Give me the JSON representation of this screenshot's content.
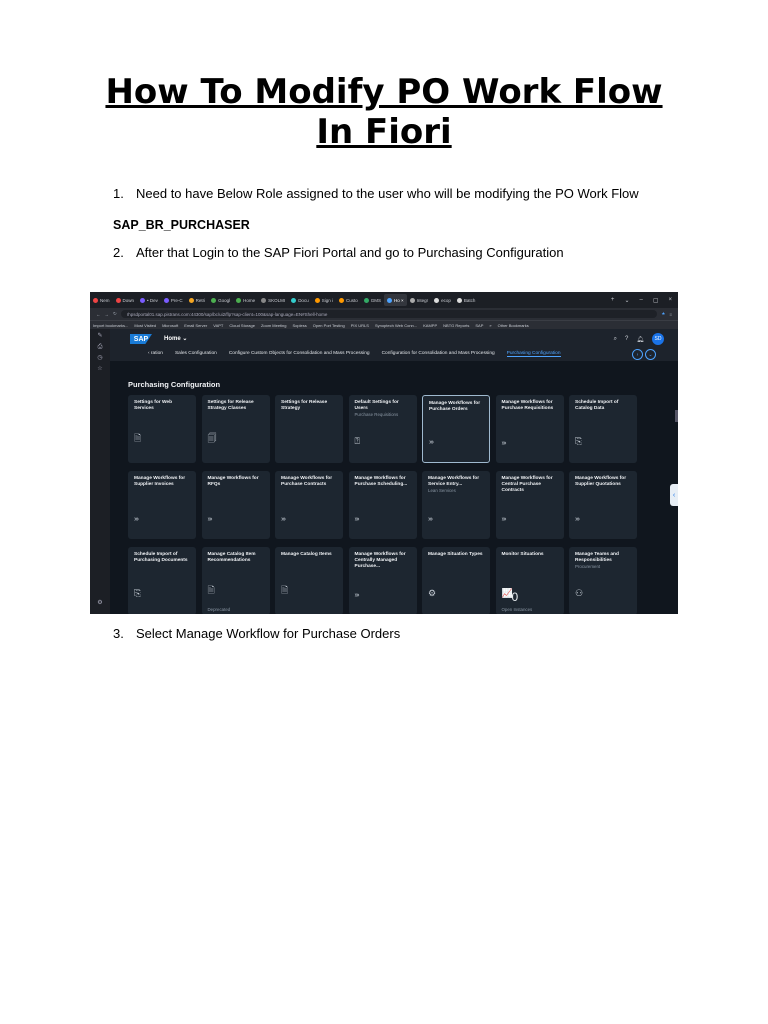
{
  "doc": {
    "title_line1": "How To Modify PO Work Flow",
    "title_line2": "In Fiori",
    "steps": [
      {
        "num": "1.",
        "text": "Need to have Below Role assigned to the user who will be modifying the PO Work Flow"
      },
      {
        "num": "2.",
        "text": "After that Login to the SAP Fiori Portal and go to Purchasing Configuration"
      },
      {
        "num": "3.",
        "text": "Select Manage Workflow for Purchase Orders"
      }
    ],
    "role": "SAP_BR_PURCHASER"
  },
  "screenshot": {
    "browser_tabs": [
      "Nem",
      "Down",
      "• Dev",
      "Pre-C",
      "Retri",
      "Googl",
      "Home",
      "SKOLMI",
      "Docu",
      "Sign i",
      "Custo",
      "GMS",
      "Ho ×",
      "Integr",
      "ecop",
      "Batch"
    ],
    "window_controls": [
      "+",
      "⌄",
      "–",
      "▢",
      "×"
    ],
    "address": "rhpsdportal01.sap.pistrans.com:44300/sap/bc/ui2/flp?sap-client=100&sap-language=EN#Shell-home",
    "bookmarks": [
      "Import bookmarks...",
      "Most Visited",
      "Microsoft",
      "Email Server",
      "VAPT",
      "Cloud Storage",
      "Zoom Meeting",
      "Sopless",
      "Open Port Testing",
      "PIX URLS",
      "Synoptech Web Conn...",
      "KAMPP",
      "NBTG Reports",
      "SAP",
      "»",
      "Other Bookmarks"
    ],
    "header": {
      "logo": "SAP",
      "home": "Home ⌄",
      "avatar": "SD",
      "nav": [
        "‹  ration",
        "Sales Configuration",
        "Configure Custom Objects for Consolidation and Mass Processing",
        "Configuration for Consolidation and Mass Processing",
        "Purchasing Configuration"
      ],
      "nav_selected_index": 4
    },
    "section": "Purchasing Configuration",
    "tiles": [
      {
        "title": "Settings for Web Services",
        "sub": "",
        "icon": "document-icon",
        "glyph": "🗎",
        "foot": ""
      },
      {
        "title": "Settings for Release Strategy Classes",
        "sub": "",
        "icon": "document-stack-icon",
        "glyph": "🗐",
        "foot": ""
      },
      {
        "title": "Settings for Release Strategy",
        "sub": "",
        "icon": "",
        "glyph": "",
        "foot": ""
      },
      {
        "title": "Default Settings for Users",
        "sub": "Purchase Requisitions",
        "icon": "user-settings-icon",
        "glyph": "⍰",
        "foot": ""
      },
      {
        "title": "Manage Workflows for Purchase Orders",
        "sub": "",
        "icon": "workflow-arrows-icon",
        "glyph": "›››",
        "foot": "",
        "highlight": true
      },
      {
        "title": "Manage Workflows for Purchase Requisitions",
        "sub": "",
        "icon": "workflow-arrows-icon",
        "glyph": "›››",
        "foot": ""
      },
      {
        "title": "Schedule Import of Catalog Data",
        "sub": "",
        "icon": "import-icon",
        "glyph": "⎘",
        "foot": ""
      },
      {
        "title": "Manage Workflows for Supplier Invoices",
        "sub": "",
        "icon": "workflow-arrows-icon",
        "glyph": "›››",
        "foot": ""
      },
      {
        "title": "Manage Workflows for RFQs",
        "sub": "",
        "icon": "workflow-arrows-icon",
        "glyph": "›››",
        "foot": ""
      },
      {
        "title": "Manage Workflows for Purchase Contracts",
        "sub": "",
        "icon": "workflow-arrows-icon",
        "glyph": "›››",
        "foot": ""
      },
      {
        "title": "Manage Workflows for Purchase Scheduling...",
        "sub": "",
        "icon": "workflow-arrows-icon",
        "glyph": "›››",
        "foot": ""
      },
      {
        "title": "Manage Workflows for Service Entry...",
        "sub": "Lean Services",
        "icon": "workflow-arrows-icon",
        "glyph": "›››",
        "foot": ""
      },
      {
        "title": "Manage Workflows for Central Purchase Contracts",
        "sub": "",
        "icon": "workflow-arrows-icon",
        "glyph": "›››",
        "foot": ""
      },
      {
        "title": "Manage Workflows for Supplier Quotations",
        "sub": "",
        "icon": "workflow-arrows-icon",
        "glyph": "›››",
        "foot": ""
      },
      {
        "title": "Schedule Import of Purchasing Documents",
        "sub": "",
        "icon": "import-icon",
        "glyph": "⎘",
        "foot": ""
      },
      {
        "title": "Manage Catalog Item Recommendations",
        "sub": "",
        "icon": "document-edit-icon",
        "glyph": "🗎",
        "foot": "Deprecated"
      },
      {
        "title": "Manage Catalog Items",
        "sub": "",
        "icon": "document-add-icon",
        "glyph": "🗎",
        "foot": ""
      },
      {
        "title": "Manage Workflows for Centrally Managed Purchase...",
        "sub": "",
        "icon": "workflow-arrows-icon",
        "glyph": "›››",
        "foot": ""
      },
      {
        "title": "Manage Situation Types",
        "sub": "",
        "icon": "situation-icon",
        "glyph": "⚙",
        "foot": ""
      },
      {
        "title": "Monitor Situations",
        "sub": "",
        "icon": "chart-icon",
        "glyph": "📈",
        "foot": "Open Instances",
        "kpi": "0"
      },
      {
        "title": "Manage Teams and Responsibilities",
        "sub": "Procurement",
        "icon": "team-icon",
        "glyph": "⚇",
        "foot": ""
      }
    ]
  }
}
